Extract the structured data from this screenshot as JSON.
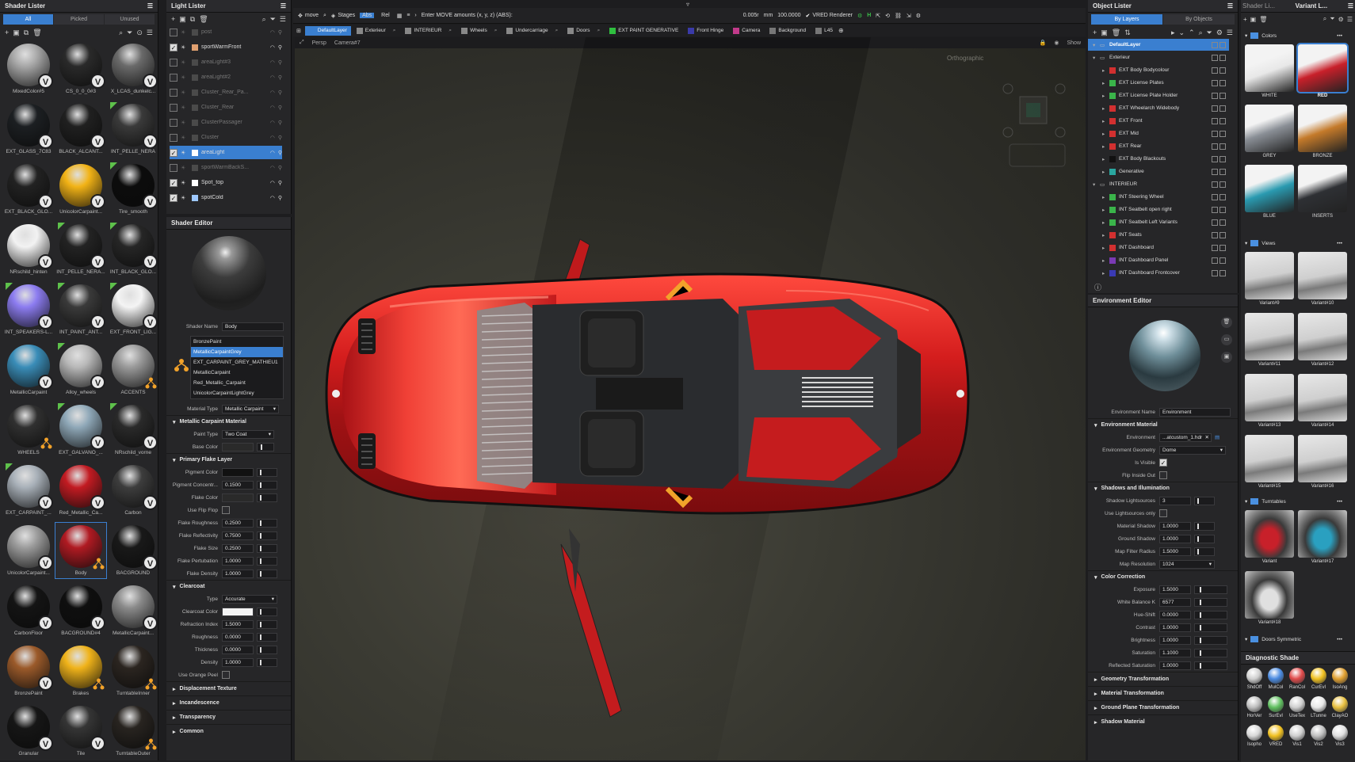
{
  "shader_lister": {
    "title": "Shader Lister",
    "tabs": [
      "All",
      "Picked",
      "Unused"
    ],
    "items": [
      {
        "label": "MixedColor#5",
        "color": "#a8a8a8",
        "badge": "v",
        "tag": false
      },
      {
        "label": "CS_0_0_0#3",
        "color": "#2a2a2a",
        "badge": "v",
        "tag": false
      },
      {
        "label": "X_LCAS_dunkelc...",
        "color": "#6a6a6a",
        "badge": "v",
        "tag": false
      },
      {
        "label": "EXT_GLASS_7C83",
        "color": "#1c1f22",
        "badge": "v",
        "tag": false
      },
      {
        "label": "BLACK_ALCANT...",
        "color": "#202020",
        "badge": "v",
        "tag": false
      },
      {
        "label": "INT_PELLE_NERA",
        "color": "#3a3a3a",
        "badge": "v",
        "tag": true
      },
      {
        "label": "EXT_BLACK_GLO...",
        "color": "#222",
        "badge": "v",
        "tag": false
      },
      {
        "label": "UnicolorCarpaint...",
        "color": "#f2b316",
        "badge": "v",
        "tag": false
      },
      {
        "label": "Tire_smooth",
        "color": "#0c0c0c",
        "badge": "v",
        "tag": true
      },
      {
        "label": "NRschild_hinten",
        "color": "#f2f2f2",
        "badge": "v",
        "tag": false
      },
      {
        "label": "INT_PELLE_NERA...",
        "color": "#232323",
        "badge": "v",
        "tag": true
      },
      {
        "label": "INT_BLACK_GLO...",
        "color": "#262626",
        "badge": "v",
        "tag": true
      },
      {
        "label": "INT_SPEAKERS-L...",
        "color": "#8c7cf0",
        "badge": "v",
        "tag": true
      },
      {
        "label": "INT_PAINT_ANT...",
        "color": "#3a3a3a",
        "badge": "v",
        "tag": true
      },
      {
        "label": "EXT_FRONT_LIG...",
        "color": "#f4f4f4",
        "badge": "v",
        "tag": true
      },
      {
        "label": "MetallicCarpaint",
        "color": "#3a8db8",
        "badge": "v",
        "tag": false
      },
      {
        "label": "Alloy_wheels",
        "color": "#b8b8b8",
        "badge": "v",
        "tag": true
      },
      {
        "label": "ACCENTS",
        "color": "#9a9a9a",
        "badge": "o",
        "tag": false
      },
      {
        "label": "WHEELS",
        "color": "#303030",
        "badge": "o",
        "tag": false
      },
      {
        "label": "EXT_GALVANO_...",
        "color": "#8fa8b8",
        "badge": "v",
        "tag": true
      },
      {
        "label": "NRschild_vorne",
        "color": "#2a2a2a",
        "badge": "v",
        "tag": true
      },
      {
        "label": "EXT_CARPAINT_...",
        "color": "#a8b0b8",
        "badge": "v",
        "tag": true
      },
      {
        "label": "Red_Metallic_Ca...",
        "color": "#c21b22",
        "badge": "v",
        "tag": false
      },
      {
        "label": "Carbon",
        "color": "#3d3d3d",
        "badge": "v",
        "tag": false
      },
      {
        "label": "UnicolorCarpaint...",
        "color": "#9c9c9c",
        "badge": "v",
        "tag": false
      },
      {
        "label": "Body",
        "color": "#b01a22",
        "badge": "o",
        "tag": false
      },
      {
        "label": "BACGROUND",
        "color": "#191919",
        "badge": "v",
        "tag": false
      },
      {
        "label": "CarbonFloor",
        "color": "#141414",
        "badge": "v",
        "tag": false
      },
      {
        "label": "BACGROUND#4",
        "color": "#0f0f0f",
        "badge": "v",
        "tag": false
      },
      {
        "label": "MetallicCarpaint...",
        "color": "#8a8a8a",
        "badge": "v",
        "tag": false
      },
      {
        "label": "BronzePaint",
        "color": "#9b5a2a",
        "badge": "v",
        "tag": false
      },
      {
        "label": "Brakes",
        "color": "#f0b31a",
        "badge": "o",
        "tag": false
      },
      {
        "label": "TurntableInner",
        "color": "#2b2520",
        "badge": "o",
        "tag": false
      },
      {
        "label": "Granular",
        "color": "#161616",
        "badge": "v",
        "tag": false
      },
      {
        "label": "Tile",
        "color": "#353535",
        "badge": "v",
        "tag": false
      },
      {
        "label": "TurntableOuter",
        "color": "#282420",
        "badge": "o",
        "tag": false
      }
    ]
  },
  "light_lister": {
    "title": "Light Lister",
    "items": [
      {
        "label": "post",
        "checked": false,
        "dim": true,
        "color": "#cc3a2a"
      },
      {
        "label": "sportWarmFront",
        "checked": true,
        "dim": false,
        "color": "#e0a070"
      },
      {
        "label": "areaLight#3",
        "checked": false,
        "dim": true,
        "color": "#bbbbbb"
      },
      {
        "label": "areaLight#2",
        "checked": false,
        "dim": true,
        "color": "#bbbbbb"
      },
      {
        "label": "Cluster_Rear_Pa...",
        "checked": false,
        "dim": true,
        "color": "#cc2a2a"
      },
      {
        "label": "Cluster_Rear",
        "checked": false,
        "dim": true,
        "color": "#cc2a2a"
      },
      {
        "label": "ClusterPassager",
        "checked": false,
        "dim": true,
        "color": "#bbbbbb"
      },
      {
        "label": "Cluster",
        "checked": false,
        "dim": true,
        "color": "#bbbbbb"
      },
      {
        "label": "areaLight",
        "checked": true,
        "dim": false,
        "color": "#ffffff"
      },
      {
        "label": "sportWarmBackS...",
        "checked": false,
        "dim": true,
        "color": "#e0a070"
      },
      {
        "label": "Spot_top",
        "checked": true,
        "dim": false,
        "color": "#ffffff"
      },
      {
        "label": "spotCold",
        "checked": true,
        "dim": false,
        "color": "#9ec8ff"
      }
    ]
  },
  "shader_editor": {
    "title": "Shader Editor",
    "shader_name_label": "Shader Name",
    "shader_name": "Body",
    "list": [
      "BronzePaint",
      "MetallicCarpaintGrey",
      "EXT_CARPAINT_GREY_MATHIEU1",
      "MetallicCarpaint",
      "Red_Metallic_Carpaint",
      "UnicolorCarpaintLightGrey"
    ],
    "material_type_label": "Material Type",
    "material_type": "Metallic Carpaint",
    "sec_metallic": "Metallic Carpaint Material",
    "paint_type_label": "Paint Type",
    "paint_type": "Two Coat",
    "base_color_label": "Base Color",
    "sec_flake": "Primary Flake Layer",
    "flake_props": [
      {
        "k": "Pigment Color",
        "v": "",
        "kind": "color",
        "sw": "#111"
      },
      {
        "k": "Pigment Concentr...",
        "v": "0.1500",
        "kind": "num"
      },
      {
        "k": "Flake Color",
        "v": "",
        "kind": "color",
        "sw": "#2a2a2a"
      },
      {
        "k": "Use Flip Flop",
        "v": "",
        "kind": "check"
      },
      {
        "k": "Flake Roughness",
        "v": "0.2500",
        "kind": "num"
      },
      {
        "k": "Flake Reflectivity",
        "v": "0.7500",
        "kind": "num"
      },
      {
        "k": "Flake Size",
        "v": "0.2500",
        "kind": "num"
      },
      {
        "k": "Flake Pertubation",
        "v": "1.0000",
        "kind": "num"
      },
      {
        "k": "Flake Density",
        "v": "1.0000",
        "kind": "num"
      }
    ],
    "sec_clearcoat": "Clearcoat",
    "clear_props": [
      {
        "k": "Type",
        "v": "Accurate",
        "kind": "drop"
      },
      {
        "k": "Clearcoat Color",
        "v": "",
        "kind": "color",
        "sw": "#f4f4f4"
      },
      {
        "k": "Refraction Index",
        "v": "1.5000",
        "kind": "num"
      },
      {
        "k": "Roughness",
        "v": "0.0000",
        "kind": "num"
      },
      {
        "k": "Thickness",
        "v": "0.0000",
        "kind": "num"
      },
      {
        "k": "Density",
        "v": "1.0000",
        "kind": "num"
      },
      {
        "k": "Use Orange Peel",
        "v": "",
        "kind": "check"
      }
    ],
    "collapsed": [
      "Displacement Texture",
      "Incandescence",
      "Transparency",
      "Common"
    ]
  },
  "toolbar": {
    "mode": "move",
    "stages": "Stages",
    "abs": "Abs",
    "rel": "Rel",
    "move_placeholder": "Enter MOVE amounts (x, y, z) (ABS):",
    "val1": "0.005r",
    "unit": "mm",
    "val2": "100.0000",
    "renderer": "VRED Renderer"
  },
  "viewsets": [
    "DefaultLayer",
    "Exterieur",
    "INTERIEUR",
    "Wheels",
    "Undercarriage",
    "Doors",
    "EXT PAINT GENERATIVE",
    "Front Hinge",
    "Camera",
    "Background",
    "L45"
  ],
  "viewset_colors": [
    "#3a7fd0",
    "#888",
    "#888",
    "#888",
    "#888",
    "#888",
    "#2fbf3f",
    "#3a3aa8",
    "#c23a8a",
    "#777",
    "#777"
  ],
  "viewport": {
    "persp": "Persp",
    "camera": "Camera#7",
    "view": "Orthographic",
    "show": "Show"
  },
  "object_lister": {
    "title": "Object Lister",
    "tabs": [
      "By Layers",
      "By Objects"
    ],
    "rows": [
      {
        "label": "DefaultLayer",
        "indent": 0,
        "color": "",
        "sel": true
      },
      {
        "label": "Exterieur",
        "indent": 0,
        "color": "",
        "sel": false
      },
      {
        "label": "EXT Body Bodycolour",
        "indent": 1,
        "color": "#d23030",
        "sel": false
      },
      {
        "label": "EXT License Plates",
        "indent": 1,
        "color": "#3ab44a",
        "sel": false
      },
      {
        "label": "EXT License Plate Holder",
        "indent": 1,
        "color": "#3ab44a",
        "sel": false
      },
      {
        "label": "EXT Wheelarch Widebody",
        "indent": 1,
        "color": "#d23030",
        "sel": false
      },
      {
        "label": "EXT Front",
        "indent": 1,
        "color": "#d23030",
        "sel": false
      },
      {
        "label": "EXT Mid",
        "indent": 1,
        "color": "#d23030",
        "sel": false
      },
      {
        "label": "EXT Rear",
        "indent": 1,
        "color": "#d23030",
        "sel": false
      },
      {
        "label": "EXT Body Blackouts",
        "indent": 1,
        "color": "#111111",
        "sel": false
      },
      {
        "label": "Generative",
        "indent": 1,
        "color": "#2aa7a0",
        "sel": false
      },
      {
        "label": "INTERIEUR",
        "indent": 0,
        "color": "",
        "sel": false
      },
      {
        "label": "INT Steering Wheel",
        "indent": 1,
        "color": "#3ab44a",
        "sel": false
      },
      {
        "label": "INT Seatbelt open right",
        "indent": 1,
        "color": "#3ab44a",
        "sel": false
      },
      {
        "label": "INT Seatbelt Left Variants",
        "indent": 1,
        "color": "#3ab44a",
        "sel": false
      },
      {
        "label": "INT Seats",
        "indent": 1,
        "color": "#d23030",
        "sel": false
      },
      {
        "label": "INT Dashboard",
        "indent": 1,
        "color": "#d23030",
        "sel": false
      },
      {
        "label": "INT Dashboard Panel",
        "indent": 1,
        "color": "#7a3ab4",
        "sel": false
      },
      {
        "label": "INT Dashboard Frontcover",
        "indent": 1,
        "color": "#3a3ab4",
        "sel": false
      }
    ]
  },
  "env_editor": {
    "title": "Environment Editor",
    "name_label": "Environment Name",
    "name": "Environment",
    "sec_material": "Environment Material",
    "env_label": "Environment",
    "env_value": "...atcustom_1.hdr",
    "geom_label": "Environment Geometry",
    "geom_value": "Dome",
    "visible_label": "Is Visible",
    "flip_label": "Flip Inside Out",
    "sec_shadows": "Shadows and Illumination",
    "shadow_props": [
      {
        "k": "Shadow Lightsources",
        "v": "3",
        "kind": "num"
      },
      {
        "k": "Use Lightsources only",
        "v": "",
        "kind": "check"
      },
      {
        "k": "Material Shadow",
        "v": "1.0000",
        "kind": "num"
      },
      {
        "k": "Ground Shadow",
        "v": "1.0000",
        "kind": "num"
      },
      {
        "k": "Map Filter Radius",
        "v": "1.5000",
        "kind": "num"
      },
      {
        "k": "Map Resolution",
        "v": "1024",
        "kind": "drop"
      }
    ],
    "sec_color": "Color Correction",
    "color_props": [
      {
        "k": "Exposure",
        "v": "1.5000"
      },
      {
        "k": "White Balance K",
        "v": "6577"
      },
      {
        "k": "Hue-Shift",
        "v": "0.0000"
      },
      {
        "k": "Contrast",
        "v": "1.0000"
      },
      {
        "k": "Brightness",
        "v": "1.0000"
      },
      {
        "k": "Saturation",
        "v": "1.1000"
      },
      {
        "k": "Reflected Saturation",
        "v": "1.0000"
      }
    ],
    "collapsed": [
      "Geometry Transformation",
      "Material Transformation",
      "Ground Plane Transformation",
      "Shadow Material"
    ]
  },
  "variant_lister": {
    "title_a": "Shader Li...",
    "title_b": "Variant L...",
    "colors_section": "Colors",
    "colors": [
      {
        "label": "WHITE",
        "c": "#e8e8e8",
        "sel": false
      },
      {
        "label": "RED",
        "c": "#c8202a",
        "sel": true
      },
      {
        "label": "GREY",
        "c": "#8a8f96",
        "sel": false
      },
      {
        "label": "BRONZE",
        "c": "#c47a2a",
        "sel": false
      },
      {
        "label": "BLUE",
        "c": "#2a9ab0",
        "sel": false
      },
      {
        "label": "INSERTS",
        "c": "#2e3034",
        "sel": false
      }
    ],
    "views_section": "Views",
    "views": [
      "Variant#9",
      "Variant#10",
      "Variant#11",
      "Variant#12",
      "Variant#13",
      "Variant#14",
      "Variant#15",
      "Variant#16"
    ],
    "turntables_section": "Turntables",
    "turntables": [
      {
        "label": "Variant",
        "c": "#c8202a"
      },
      {
        "label": "Variant#17",
        "c": "#2aa0c0"
      },
      {
        "label": "Variant#18",
        "c": "#e0e0e0"
      }
    ],
    "doors_section": "Doors Symmetric"
  },
  "diagnostic": {
    "title": "Diagnostic Shade",
    "items": [
      {
        "label": "ShdOff",
        "c": "#cfcfcf"
      },
      {
        "label": "MulCol",
        "c": "#4a8ae0"
      },
      {
        "label": "RanCol",
        "c": "#e04a4a"
      },
      {
        "label": "CurEvl",
        "c": "#f0c020"
      },
      {
        "label": "IsoAng",
        "c": "#e0a030"
      },
      {
        "label": "HorVer",
        "c": "#bdbdbd"
      },
      {
        "label": "SurEvl",
        "c": "#60c060"
      },
      {
        "label": "UseTex",
        "c": "#d0d0d0"
      },
      {
        "label": "LTunne",
        "c": "#e8e8e8"
      },
      {
        "label": "ClayAO",
        "c": "#e8c040"
      },
      {
        "label": "Isopho",
        "c": "#d8d8d8"
      },
      {
        "label": "VRED",
        "c": "#f0c020"
      },
      {
        "label": "Vis1",
        "c": "#d0d0d0"
      },
      {
        "label": "Vis2",
        "c": "#c0c0c0"
      },
      {
        "label": "Vis3",
        "c": "#e0e0e0"
      }
    ]
  }
}
